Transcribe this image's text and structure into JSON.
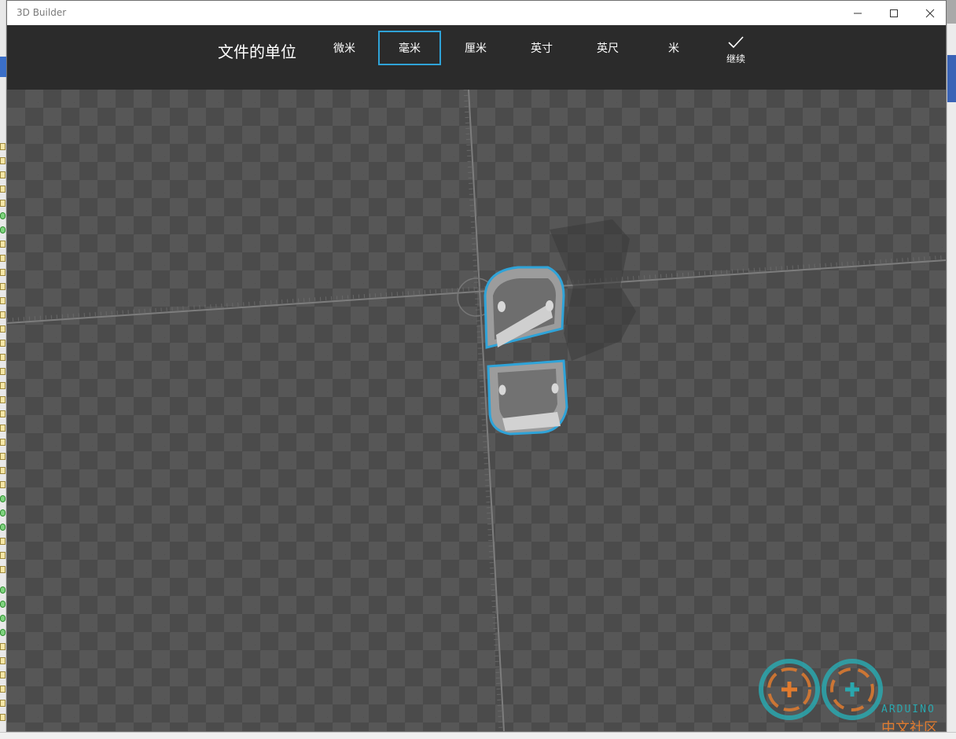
{
  "window": {
    "title": "3D Builder"
  },
  "toolbar": {
    "heading": "文件的单位",
    "units": [
      {
        "label": "微米",
        "selected": false
      },
      {
        "label": "毫米",
        "selected": true
      },
      {
        "label": "厘米",
        "selected": false
      },
      {
        "label": "英寸",
        "selected": false
      },
      {
        "label": "英尺",
        "selected": false
      },
      {
        "label": "米",
        "selected": false
      }
    ],
    "continue_label": "继续",
    "continue_icon": "checkmark-icon"
  },
  "colors": {
    "accent": "#2fa3d8",
    "toolbar_bg": "#2b2b2b",
    "grid_dark": "#4b4b4b",
    "grid_light": "#575757"
  },
  "watermark": {
    "brand": "ARDUINO",
    "subtitle": "中文社区"
  }
}
